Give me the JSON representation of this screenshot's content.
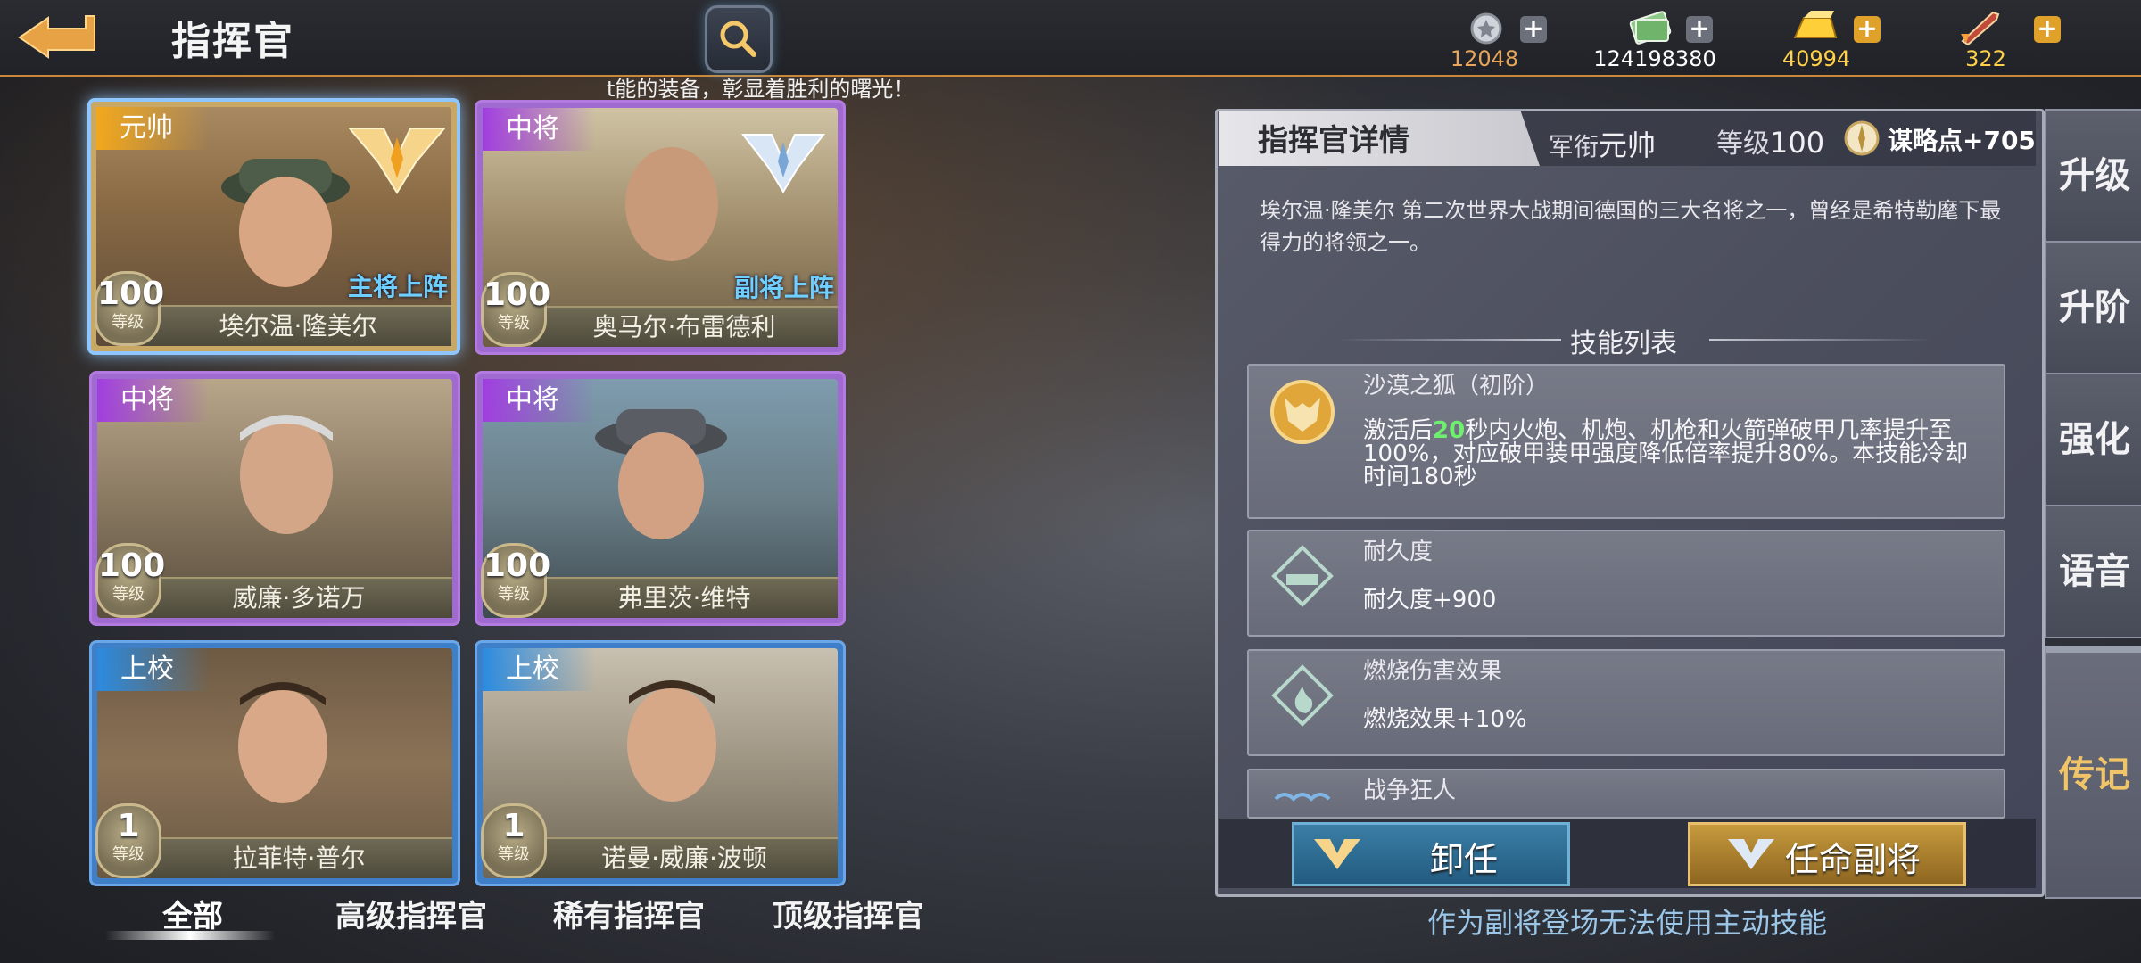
{
  "header": {
    "title": "指挥官",
    "ticker": "t能的装备，彰显着胜利的曙光！"
  },
  "resources": [
    {
      "name": "medal",
      "icon": "medal-icon",
      "value": "12048",
      "color": "#e8a65a"
    },
    {
      "name": "cash",
      "icon": "cash-icon",
      "value": "124198380",
      "color": "#ffffff"
    },
    {
      "name": "gold",
      "icon": "gold-bar-icon",
      "value": "40994",
      "color": "#ffd04a"
    },
    {
      "name": "fuel",
      "icon": "rocket-icon",
      "value": "322",
      "color": "#ffd04a"
    }
  ],
  "commanders": [
    {
      "rank": "元帅",
      "name": "埃尔温·隆美尔",
      "level": "100",
      "level_caption": "等级",
      "tag": "主将上阵",
      "rank_color": "#f2a81d",
      "selected": true
    },
    {
      "rank": "中将",
      "name": "奥马尔·布雷德利",
      "level": "100",
      "level_caption": "等级",
      "tag": "副将上阵",
      "rank_color": "#a13ee0"
    },
    {
      "rank": "中将",
      "name": "威廉·多诺万",
      "level": "100",
      "level_caption": "等级",
      "tag": "",
      "rank_color": "#a13ee0"
    },
    {
      "rank": "中将",
      "name": "弗里茨·维特",
      "level": "100",
      "level_caption": "等级",
      "tag": "",
      "rank_color": "#a13ee0"
    },
    {
      "rank": "上校",
      "name": "拉菲特·普尔",
      "level": "1",
      "level_caption": "等级",
      "tag": "",
      "rank_color": "#2b8be0"
    },
    {
      "rank": "上校",
      "name": "诺曼·威廉·波顿",
      "level": "1",
      "level_caption": "等级",
      "tag": "",
      "rank_color": "#2b8be0"
    }
  ],
  "filters": {
    "all": "全部",
    "senior": "高级指挥官",
    "rare": "稀有指挥官",
    "top": "顶级指挥官"
  },
  "detail": {
    "title": "指挥官详情",
    "rank_label": "军衔",
    "rank_value": "元帅",
    "level_label": "等级",
    "level_value": "100",
    "strategy": "谋略点+705",
    "description": "埃尔温·隆美尔 第二次世界大战期间德国的三大名将之一，曾经是希特勒麾下最得力的将领之一。",
    "skills_title": "技能列表",
    "skills": [
      {
        "name": "沙漠之狐（初阶）",
        "icon": "fox-icon",
        "desc_pre": "激活后",
        "desc_hl": "20",
        "desc_post": "秒内火炮、机炮、机枪和火箭弹破甲几率提升至100%，对应破甲装甲强度降低倍率提升80%。本技能冷却时间180秒"
      },
      {
        "name": "耐久度",
        "icon": "armor-icon",
        "desc": "耐久度+900"
      },
      {
        "name": "燃烧伤害效果",
        "icon": "fire-icon",
        "desc": "燃烧效果+10%"
      },
      {
        "name": "战争狂人",
        "icon": "madman-icon",
        "desc": ""
      }
    ],
    "dismiss": "卸任",
    "appoint": "任命副将",
    "hint": "作为副将登场无法使用主动技能"
  },
  "side_tabs": [
    "升级",
    "升阶",
    "强化",
    "语音",
    "传记"
  ],
  "active_side_tab": "传记"
}
